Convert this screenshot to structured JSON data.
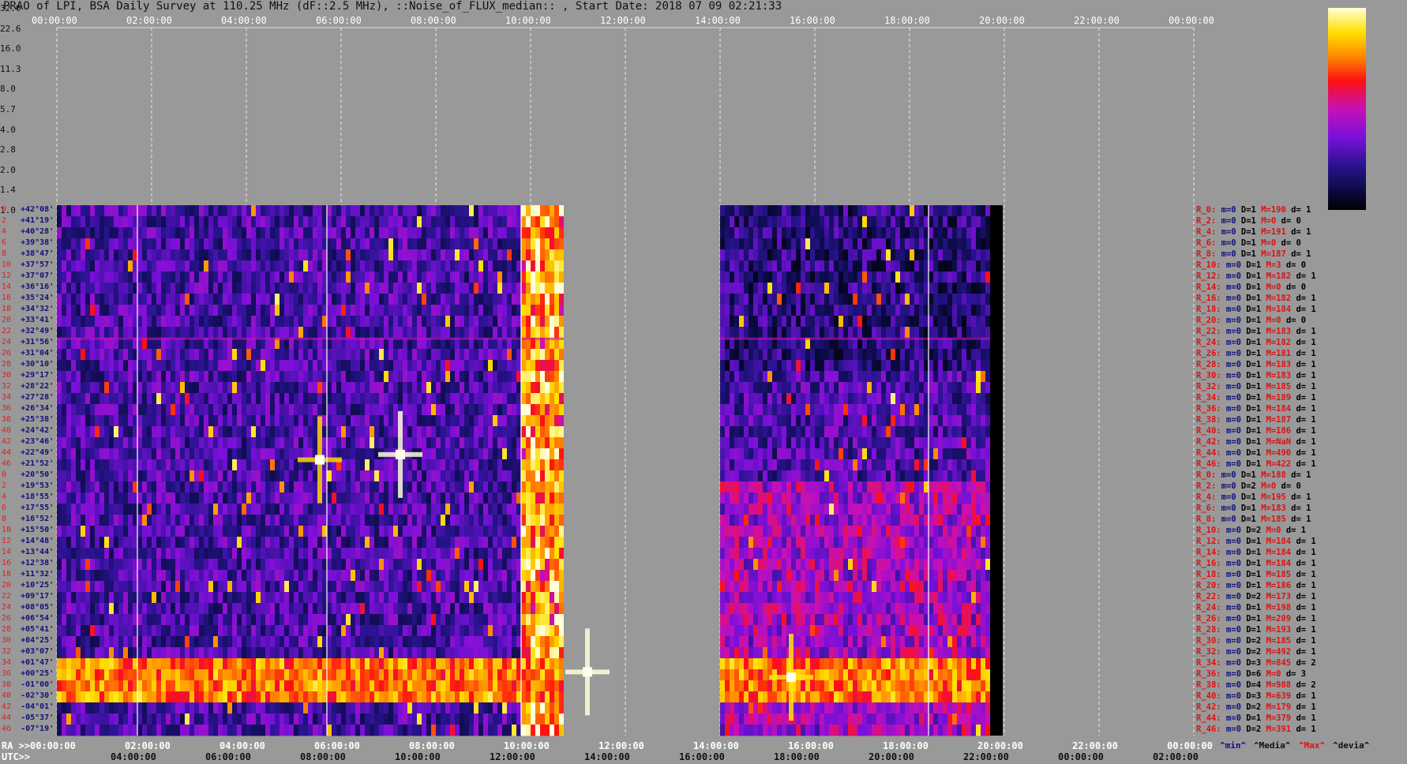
{
  "title": "PRAO of LPI, BSA Daily Survey at 110.25 MHz (dF::2.5 MHz), ::Noise_of_FLUX_median:: , Start Date: 2018 07 09 02:21:33",
  "top_ticks": [
    "00:00:00",
    "02:00:00",
    "04:00:00",
    "06:00:00",
    "08:00:00",
    "10:00:00",
    "12:00:00",
    "14:00:00",
    "16:00:00",
    "18:00:00",
    "20:00:00",
    "22:00:00",
    "00:00:00"
  ],
  "ra_prefix": "RA >>",
  "ra_ticks": [
    "00:00:00",
    "02:00:00",
    "04:00:00",
    "06:00:00",
    "08:00:00",
    "10:00:00",
    "12:00:00",
    "14:00:00",
    "16:00:00",
    "18:00:00",
    "20:00:00",
    "22:00:00",
    "00:00:00"
  ],
  "utc_prefix": "UTC>>",
  "utc_ticks": [
    "04:00:00",
    "06:00:00",
    "08:00:00",
    "10:00:00",
    "12:00:00",
    "14:00:00",
    "16:00:00",
    "18:00:00",
    "20:00:00",
    "22:00:00",
    "00:00:00",
    "02:00:00"
  ],
  "colorbar": {
    "labels": [
      "32.0",
      "22.6",
      "16.0",
      "11.3",
      "8.0",
      "5.7",
      "4.0",
      "2.8",
      "2.0",
      "1.4",
      "1.0"
    ]
  },
  "declinations": [
    "+42°08'",
    "+41°19'",
    "+40°28'",
    "+39°38'",
    "+38°47'",
    "+37°57'",
    "+37°07'",
    "+36°16'",
    "+35°24'",
    "+34°32'",
    "+33°41'",
    "+32°49'",
    "+31°56'",
    "+31°04'",
    "+30°10'",
    "+29°17'",
    "+28°22'",
    "+27°28'",
    "+26°34'",
    "+25°38'",
    "+24°42'",
    "+23°46'",
    "+22°49'",
    "+21°52'",
    "+20°50'",
    "+19°53'",
    "+18°55'",
    "+17°55'",
    "+16°52'",
    "+15°50'",
    "+14°48'",
    "+13°44'",
    "+12°38'",
    "+11°32'",
    "+10°25'",
    "+09°17'",
    "+08°05'",
    "+06°54'",
    "+05°41'",
    "+04°25'",
    "+03°07'",
    "+01°47'",
    "+00°25'",
    "-01°00'",
    "-02°30'",
    "-04°01'",
    "-05°37'",
    "-07°19'"
  ],
  "row_numbers": [
    "0",
    "2",
    "4",
    "6",
    "8",
    "10",
    "12",
    "14",
    "16",
    "18",
    "20",
    "22",
    "24",
    "26",
    "28",
    "30",
    "32",
    "34",
    "36",
    "38",
    "40",
    "42",
    "44",
    "46",
    "0",
    "2",
    "4",
    "6",
    "8",
    "10",
    "12",
    "14",
    "16",
    "18",
    "20",
    "22",
    "24",
    "26",
    "28",
    "30",
    "32",
    "34",
    "36",
    "38",
    "40",
    "42",
    "44",
    "46"
  ],
  "stats": [
    [
      "R_0:",
      "m=0",
      "D=1",
      "M=190",
      "d= 1"
    ],
    [
      "R_2:",
      "m=0",
      "D=1",
      "M=0",
      "d= 0"
    ],
    [
      "R_4:",
      "m=0",
      "D=1",
      "M=191",
      "d= 1"
    ],
    [
      "R_6:",
      "m=0",
      "D=1",
      "M=0",
      "d= 0"
    ],
    [
      "R_8:",
      "m=0",
      "D=1",
      "M=187",
      "d= 1"
    ],
    [
      "R_10:",
      "m=0",
      "D=1",
      "M=3",
      "d= 0"
    ],
    [
      "R_12:",
      "m=0",
      "D=1",
      "M=182",
      "d= 1"
    ],
    [
      "R_14:",
      "m=0",
      "D=1",
      "M=0",
      "d= 0"
    ],
    [
      "R_16:",
      "m=0",
      "D=1",
      "M=182",
      "d= 1"
    ],
    [
      "R_18:",
      "m=0",
      "D=1",
      "M=184",
      "d= 1"
    ],
    [
      "R_20:",
      "m=0",
      "D=1",
      "M=0",
      "d= 0"
    ],
    [
      "R_22:",
      "m=0",
      "D=1",
      "M=183",
      "d= 1"
    ],
    [
      "R_24:",
      "m=0",
      "D=1",
      "M=182",
      "d= 1"
    ],
    [
      "R_26:",
      "m=0",
      "D=1",
      "M=181",
      "d= 1"
    ],
    [
      "R_28:",
      "m=0",
      "D=1",
      "M=183",
      "d= 1"
    ],
    [
      "R_30:",
      "m=0",
      "D=1",
      "M=183",
      "d= 1"
    ],
    [
      "R_32:",
      "m=0",
      "D=1",
      "M=185",
      "d= 1"
    ],
    [
      "R_34:",
      "m=0",
      "D=1",
      "M=189",
      "d= 1"
    ],
    [
      "R_36:",
      "m=0",
      "D=1",
      "M=184",
      "d= 1"
    ],
    [
      "R_38:",
      "m=0",
      "D=1",
      "M=187",
      "d= 1"
    ],
    [
      "R_40:",
      "m=0",
      "D=1",
      "M=186",
      "d= 1"
    ],
    [
      "R_42:",
      "m=0",
      "D=1",
      "M=NaN",
      "d= 1"
    ],
    [
      "R_44:",
      "m=0",
      "D=1",
      "M=490",
      "d= 1"
    ],
    [
      "R_46:",
      "m=0",
      "D=1",
      "M=422",
      "d= 1"
    ],
    [
      "R_0:",
      "m=0",
      "D=1",
      "M=188",
      "d= 1"
    ],
    [
      "R_2:",
      "m=0",
      "D=2",
      "M=0",
      "d= 0"
    ],
    [
      "R_4:",
      "m=0",
      "D=1",
      "M=195",
      "d= 1"
    ],
    [
      "R_6:",
      "m=0",
      "D=1",
      "M=183",
      "d= 1"
    ],
    [
      "R_8:",
      "m=0",
      "D=1",
      "M=185",
      "d= 1"
    ],
    [
      "R_10:",
      "m=0",
      "D=2",
      "M=0",
      "d= 1"
    ],
    [
      "R_12:",
      "m=0",
      "D=1",
      "M=184",
      "d= 1"
    ],
    [
      "R_14:",
      "m=0",
      "D=1",
      "M=184",
      "d= 1"
    ],
    [
      "R_16:",
      "m=0",
      "D=1",
      "M=184",
      "d= 1"
    ],
    [
      "R_18:",
      "m=0",
      "D=1",
      "M=185",
      "d= 1"
    ],
    [
      "R_20:",
      "m=0",
      "D=1",
      "M=186",
      "d= 1"
    ],
    [
      "R_22:",
      "m=0",
      "D=2",
      "M=173",
      "d= 1"
    ],
    [
      "R_24:",
      "m=0",
      "D=1",
      "M=198",
      "d= 1"
    ],
    [
      "R_26:",
      "m=0",
      "D=1",
      "M=209",
      "d= 1"
    ],
    [
      "R_28:",
      "m=0",
      "D=1",
      "M=193",
      "d= 1"
    ],
    [
      "R_30:",
      "m=0",
      "D=2",
      "M=185",
      "d= 1"
    ],
    [
      "R_32:",
      "m=0",
      "D=2",
      "M=492",
      "d= 1"
    ],
    [
      "R_34:",
      "m=0",
      "D=3",
      "M=845",
      "d= 2"
    ],
    [
      "R_36:",
      "m=0",
      "D=6",
      "M=0",
      "d= 3"
    ],
    [
      "R_38:",
      "m=0",
      "D=4",
      "M=988",
      "d= 2"
    ],
    [
      "R_40:",
      "m=0",
      "D=3",
      "M=639",
      "d= 1"
    ],
    [
      "R_42:",
      "m=0",
      "D=2",
      "M=179",
      "d= 1"
    ],
    [
      "R_44:",
      "m=0",
      "D=1",
      "M=379",
      "d= 1"
    ],
    [
      "R_46:",
      "m=0",
      "D=2",
      "M=391",
      "d= 1"
    ]
  ],
  "stat_legend": [
    "^min^",
    "^Media^",
    "^Max^",
    "^devia^"
  ],
  "chart_data": {
    "type": "heatmap",
    "title": "PRAO of LPI, BSA Daily Survey at 110.25 MHz (dF::2.5 MHz), ::Noise_of_FLUX_median:: , Start Date: 2018 07 09 02:21:33",
    "x_axis": "RA (hours)",
    "xlim": [
      0,
      24
    ],
    "rows": 48,
    "data_segments_ra": [
      [
        0.0,
        10.7
      ],
      [
        14.0,
        19.7
      ]
    ],
    "scale": "log",
    "colorbar_range": [
      1.0,
      32.0
    ],
    "bright_sources": [
      {
        "ra": 7.25,
        "row_frac": 0.47,
        "level": 32
      },
      {
        "ra": 5.55,
        "row_frac": 0.48,
        "level": 20
      },
      {
        "ra": 11.2,
        "row_frac": 0.88,
        "level": 32
      },
      {
        "ra": 15.5,
        "row_frac": 0.89,
        "level": 22
      }
    ]
  }
}
